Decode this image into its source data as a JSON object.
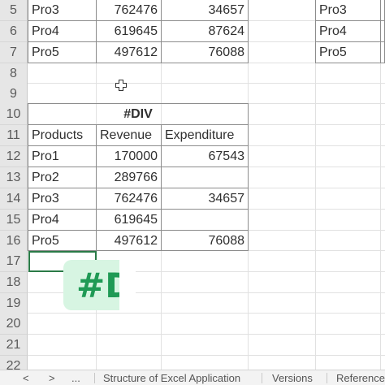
{
  "row_numbers": [
    "5",
    "6",
    "7",
    "8",
    "9",
    "10",
    "11",
    "12",
    "13",
    "14",
    "15",
    "16",
    "17",
    "18",
    "19",
    "20",
    "21",
    "22"
  ],
  "top_table": {
    "rows": [
      {
        "product": "Pro3",
        "revenue": "762476",
        "expenditure": "34657"
      },
      {
        "product": "Pro4",
        "revenue": "619645",
        "expenditure": "87624"
      },
      {
        "product": "Pro5",
        "revenue": "497612",
        "expenditure": "76088"
      }
    ]
  },
  "right_table": {
    "rows": [
      "Pro3",
      "Pro4",
      "Pro5"
    ]
  },
  "main_table": {
    "title": "#DIV",
    "headers": {
      "products": "Products",
      "revenue": "Revenue",
      "expenditure": "Expenditure"
    },
    "rows": [
      {
        "product": "Pro1",
        "revenue": "170000",
        "expenditure": "67543"
      },
      {
        "product": "Pro2",
        "revenue": "289766",
        "expenditure": ""
      },
      {
        "product": "Pro3",
        "revenue": "762476",
        "expenditure": "34657"
      },
      {
        "product": "Pro4",
        "revenue": "619645",
        "expenditure": ""
      },
      {
        "product": "Pro5",
        "revenue": "497612",
        "expenditure": "76088"
      }
    ]
  },
  "badge": {
    "text": "#D",
    "color": "#1f9a55",
    "background": "#d7f5e2"
  },
  "sheet_tabs": {
    "prev": "<",
    "next": ">",
    "more": "...",
    "tab1": "Structure of Excel Application",
    "tab2": "Versions",
    "tab3": "Reference"
  },
  "colors": {
    "selection_border": "#2a7a47"
  }
}
